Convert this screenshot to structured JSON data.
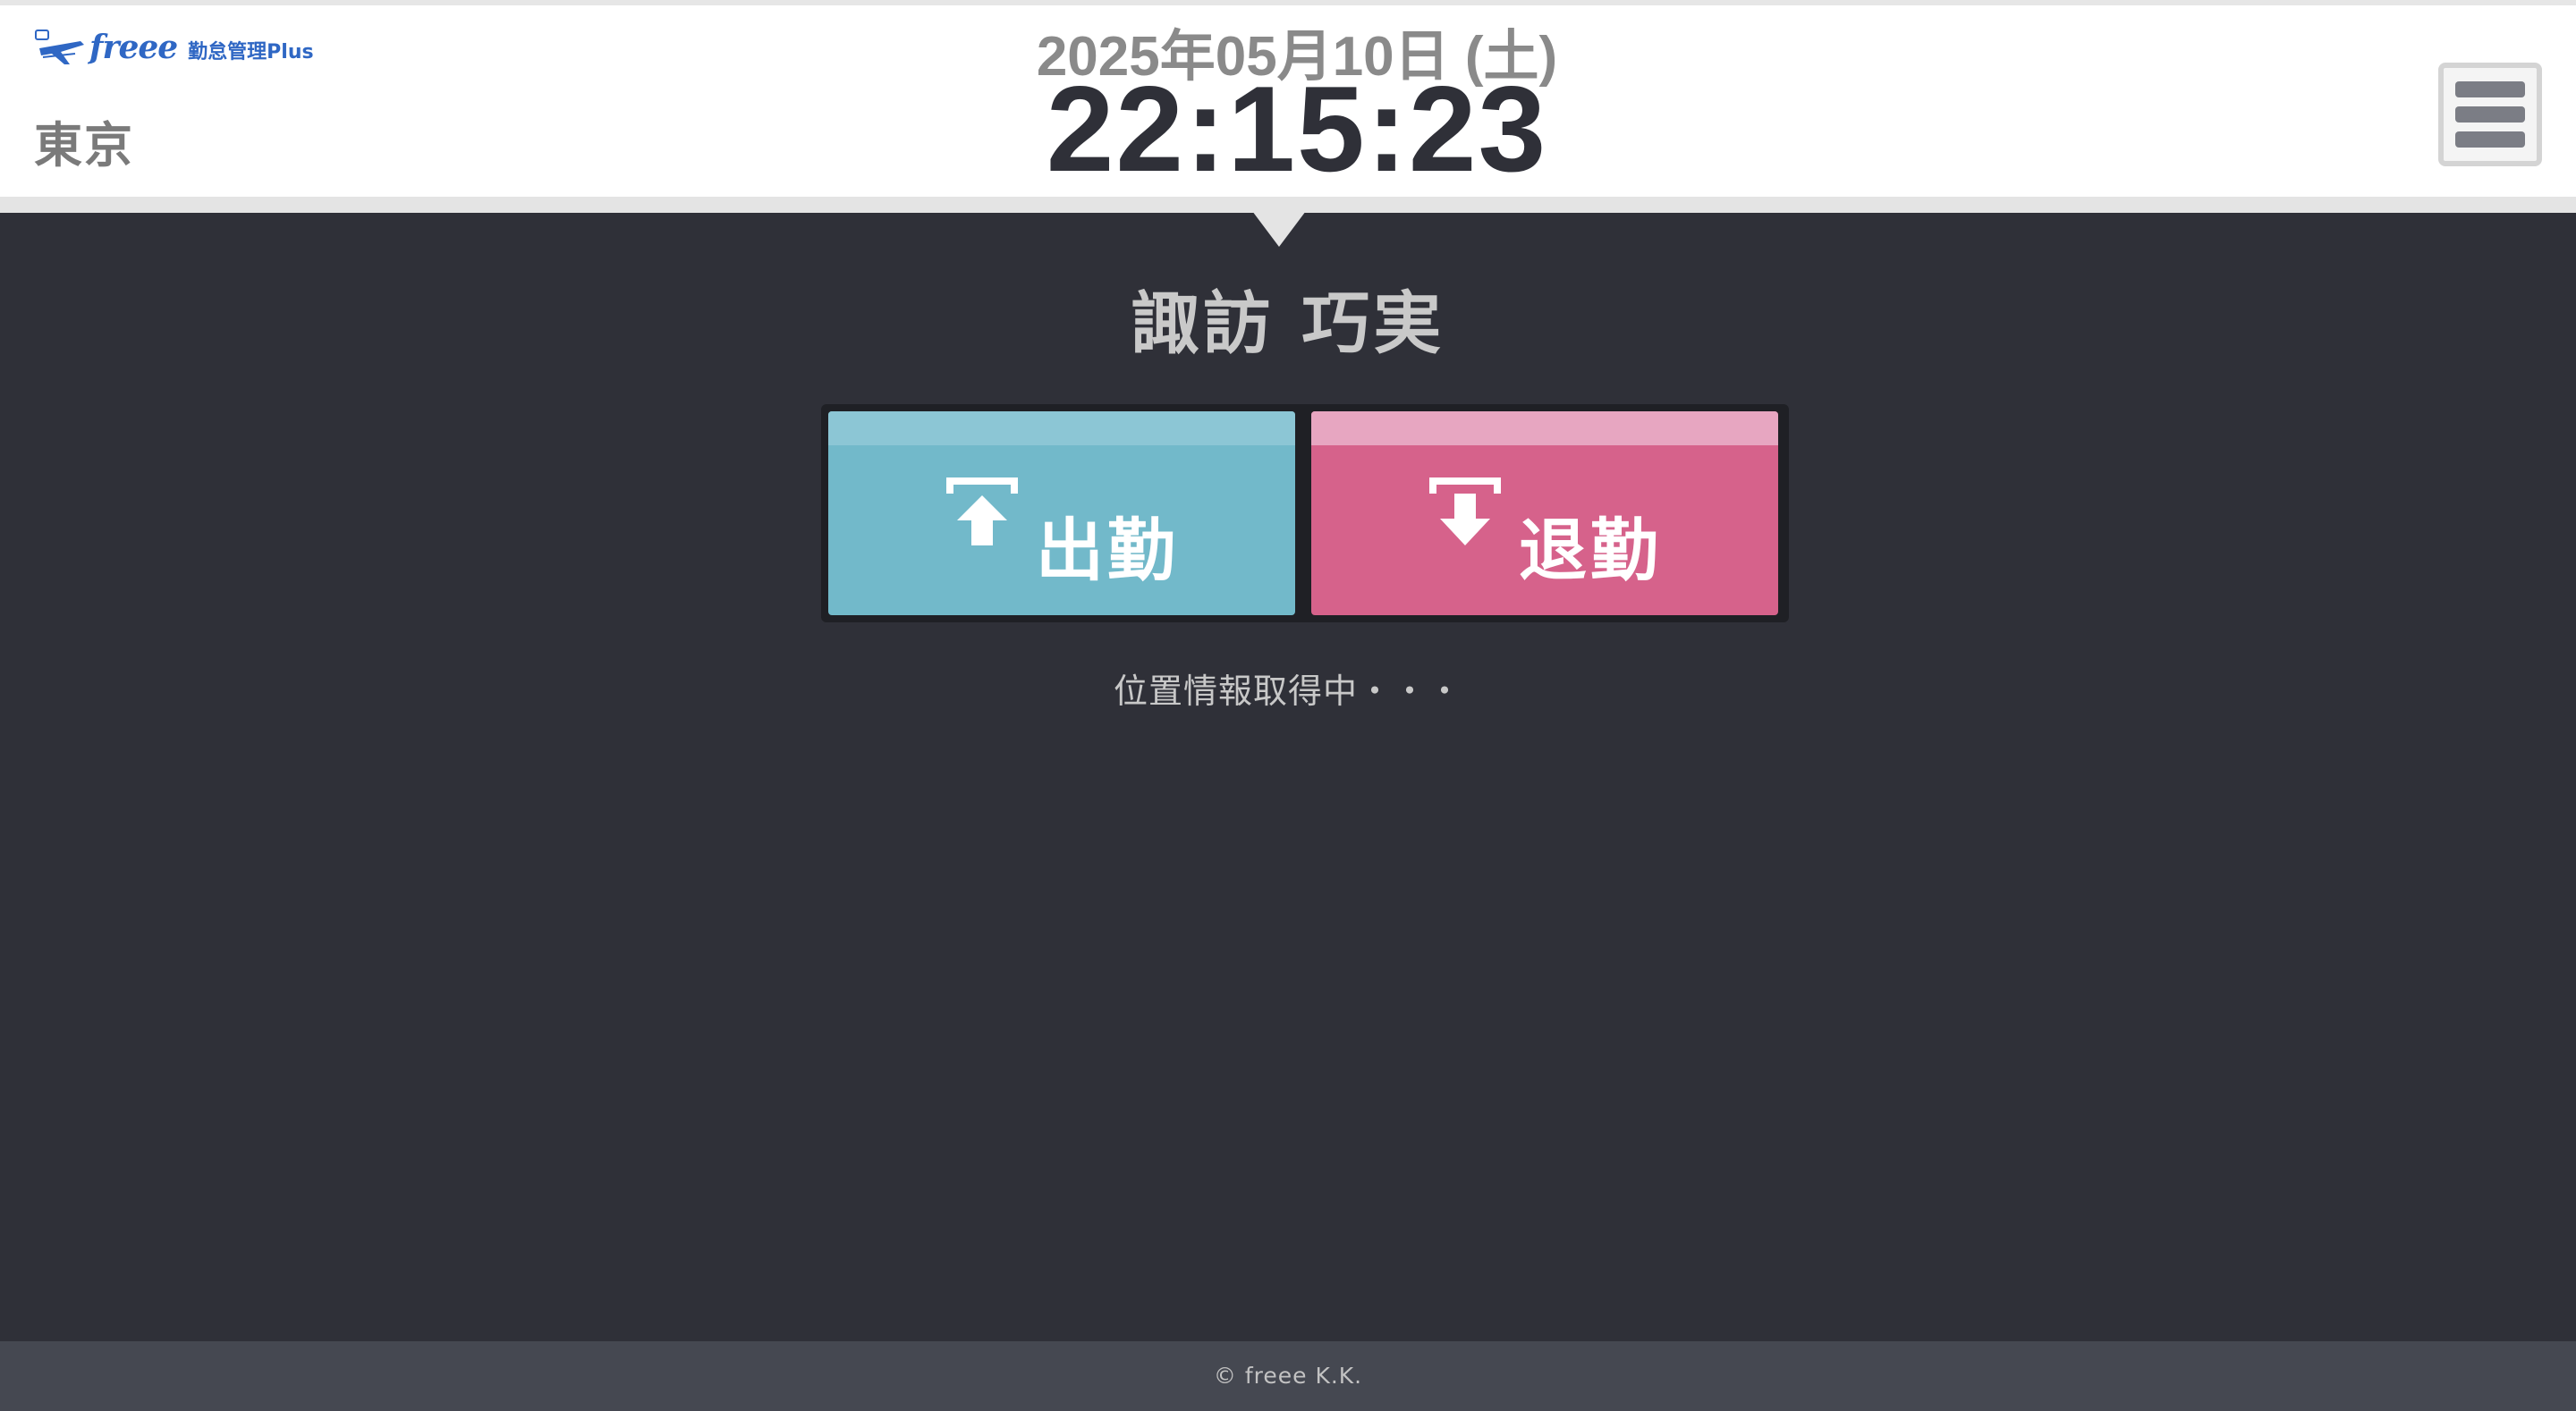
{
  "header": {
    "logo_wordmark": "freee",
    "logo_product": "勤怠管理Plus",
    "location": "東京",
    "date": "2025年05月10日 (土)",
    "time": "22:15:23",
    "menu_icon": "hamburger-menu-icon"
  },
  "main": {
    "employee_name": "諏訪 巧実",
    "clock_in": {
      "label": "出勤",
      "icon": "arrow-up-into-bracket-icon",
      "color": "#72b9ca"
    },
    "clock_out": {
      "label": "退勤",
      "icon": "arrow-down-from-bracket-icon",
      "color": "#d6628b"
    },
    "status": "位置情報取得中・・・"
  },
  "footer": {
    "copyright": "© freee K.K."
  }
}
